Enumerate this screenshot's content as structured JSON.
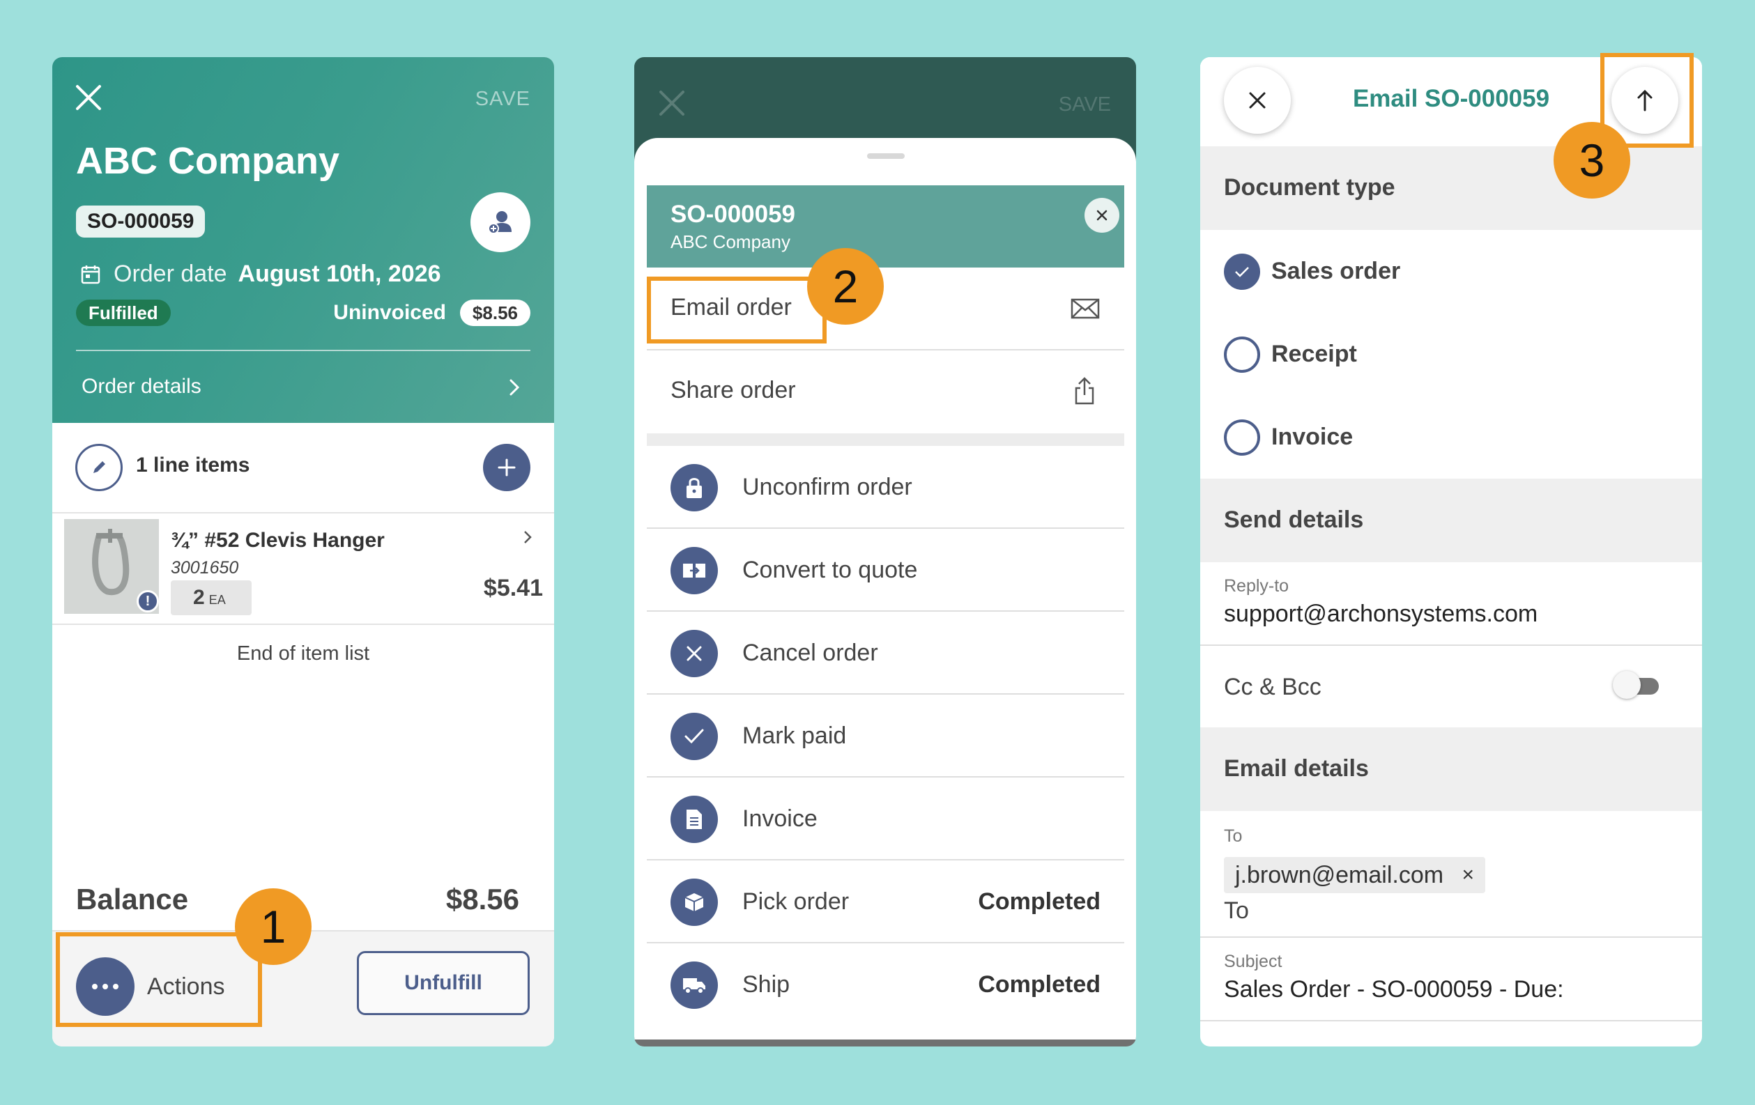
{
  "screen1": {
    "save_label": "SAVE",
    "company": "ABC Company",
    "order_number": "SO-000059",
    "order_date_label": "Order date",
    "order_date": "August 10th, 2026",
    "fulfillment_status": "Fulfilled",
    "invoice_status": "Uninvoiced",
    "invoice_amount": "$8.56",
    "order_details_label": "Order details",
    "line_items_label": "1 line items",
    "item": {
      "name": "¾” #52 Clevis Hanger",
      "sku": "3001650",
      "qty": "2",
      "unit": "EA",
      "price": "$5.41"
    },
    "end_of_list": "End of item list",
    "balance_label": "Balance",
    "balance_value": "$8.56",
    "actions_label": "Actions",
    "unfulfill_label": "Unfulfill"
  },
  "screen2": {
    "save_label": "SAVE",
    "order_number": "SO-000059",
    "company": "ABC Company",
    "quick_actions": [
      {
        "label": "Email order",
        "icon": "mail-icon"
      },
      {
        "label": "Share order",
        "icon": "share-icon"
      }
    ],
    "actions": [
      {
        "label": "Unconfirm order",
        "icon": "lock-icon",
        "status": ""
      },
      {
        "label": "Convert to quote",
        "icon": "convert-icon",
        "status": ""
      },
      {
        "label": "Cancel order",
        "icon": "x-icon",
        "status": ""
      },
      {
        "label": "Mark paid",
        "icon": "check-icon",
        "status": ""
      },
      {
        "label": "Invoice",
        "icon": "document-icon",
        "status": ""
      },
      {
        "label": "Pick order",
        "icon": "box-icon",
        "status": "Completed"
      },
      {
        "label": "Ship",
        "icon": "truck-icon",
        "status": "Completed"
      }
    ]
  },
  "screen3": {
    "title": "Email SO-000059",
    "document_type_label": "Document type",
    "doc_types": [
      {
        "label": "Sales order",
        "selected": true
      },
      {
        "label": "Receipt",
        "selected": false
      },
      {
        "label": "Invoice",
        "selected": false
      }
    ],
    "send_details_label": "Send details",
    "reply_to_label": "Reply-to",
    "reply_to_value": "support@archonsystems.com",
    "cc_bcc_label": "Cc & Bcc",
    "email_details_label": "Email details",
    "to_label": "To",
    "to_chip": "j.brown@email.com",
    "chip_close": "×",
    "to_placeholder": "To",
    "subject_label": "Subject",
    "subject_value": "Sales Order - SO-000059 - Due:"
  },
  "steps": [
    "1",
    "2",
    "3"
  ],
  "colors": {
    "background": "#9ee0dc",
    "header_teal": "#3a9c8d",
    "accent_navy": "#4c5e8b",
    "highlight_orange": "#f09a24",
    "fulfilled_green": "#1f7a52"
  }
}
